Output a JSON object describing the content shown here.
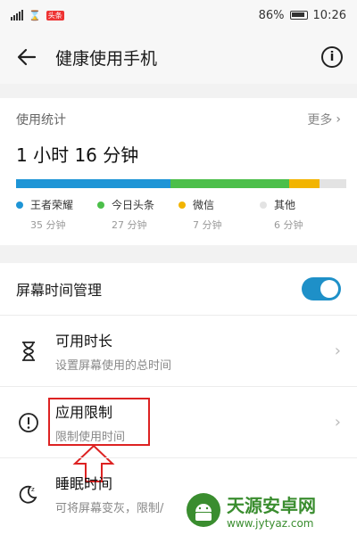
{
  "status_bar": {
    "battery": "86%",
    "time": "10:26",
    "tag": "头条"
  },
  "header": {
    "title": "健康使用手机"
  },
  "usage": {
    "label": "使用统计",
    "more": "更多",
    "total": "1 小时 16 分钟",
    "apps": [
      {
        "name": "王者荣耀",
        "minutes_label": "35 分钟",
        "minutes": 35,
        "color": "#1e95d6"
      },
      {
        "name": "今日头条",
        "minutes_label": "27 分钟",
        "minutes": 27,
        "color": "#4cbf4a"
      },
      {
        "name": "微信",
        "minutes_label": "7 分钟",
        "minutes": 7,
        "color": "#f2b400"
      },
      {
        "name": "其他",
        "minutes_label": "6 分钟",
        "minutes": 6,
        "color": "#e3e3e3"
      }
    ]
  },
  "screen_time": {
    "label": "屏幕时间管理",
    "enabled": true,
    "items": [
      {
        "title": "可用时长",
        "subtitle": "设置屏幕使用的总时间",
        "icon": "hourglass-icon"
      },
      {
        "title": "应用限制",
        "subtitle": "限制使用时间",
        "icon": "alert-circle-icon"
      },
      {
        "title": "睡眠时间",
        "subtitle": "可将屏幕变灰，限制/",
        "icon": "moon-icon"
      }
    ]
  },
  "watermark": {
    "title": "天源安卓网",
    "url": "www.jytyaz.com"
  }
}
